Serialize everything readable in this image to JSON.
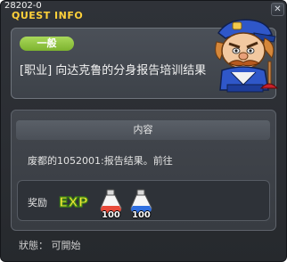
{
  "window": {
    "quest_id": "28202-0",
    "title": "QUEST INFO",
    "close_symbol": "✕"
  },
  "quest": {
    "category": "一般",
    "title": "[职业] 向达克鲁的分身报告培训结果",
    "npc": "npc-portrait"
  },
  "content": {
    "header": "内容",
    "description": "废都的1052001:报告结果。前往"
  },
  "rewards": {
    "label": "奖励",
    "exp_icon": "exp-icon",
    "exp_text": "EXP",
    "items": [
      {
        "icon": "red-potion-icon",
        "quantity": "100",
        "color": "#e84a3a"
      },
      {
        "icon": "blue-potion-icon",
        "quantity": "100",
        "color": "#2f6fe0"
      }
    ]
  },
  "status": {
    "text": "狀態： 可開始"
  },
  "colors": {
    "title_accent": "#ffd13a",
    "badge_green": "#8cc43c"
  }
}
